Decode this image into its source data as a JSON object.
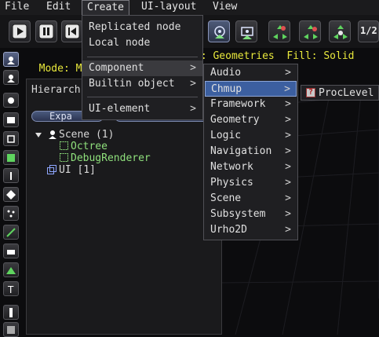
{
  "menubar": {
    "items": [
      {
        "label": "File"
      },
      {
        "label": "Edit"
      },
      {
        "label": "Create",
        "active": true
      },
      {
        "label": "UI-layout"
      },
      {
        "label": "View"
      }
    ]
  },
  "toolbar": {
    "buttons": [
      {
        "icon": "play-icon"
      },
      {
        "icon": "pause-icon"
      },
      {
        "icon": "skip-back-icon"
      },
      {
        "icon": "camera-node-icon",
        "selected": true
      },
      {
        "icon": "camera-local-icon"
      },
      {
        "icon": "move-gizmo-icon"
      },
      {
        "icon": "rotate-gizmo-icon"
      },
      {
        "icon": "scale-gizmo-icon"
      },
      {
        "icon": "half-scale-icon",
        "text": "1/2"
      }
    ]
  },
  "modeline": {
    "left": "Mode: Mov",
    "right": "k: Geometries  Fill: Solid"
  },
  "hierarchy": {
    "title": "Hierarch",
    "expand_label": "Expa",
    "tree": {
      "scene": "Scene (1)",
      "octree": "Octree",
      "debug_renderer": "DebugRenderer",
      "ui": "UI [1]"
    }
  },
  "create_menu": {
    "items": [
      {
        "label": "Replicated node"
      },
      {
        "label": "Local node"
      },
      {
        "label": "Component",
        "submenu": true,
        "highlighted": true
      },
      {
        "label": "Builtin object",
        "submenu": true
      },
      {
        "label": "UI-element",
        "submenu": true
      }
    ],
    "arrow": ">"
  },
  "component_menu": {
    "items": [
      {
        "label": "Audio"
      },
      {
        "label": "Chmup",
        "highlighted": true
      },
      {
        "label": "Framework"
      },
      {
        "label": "Geometry"
      },
      {
        "label": "Logic"
      },
      {
        "label": "Navigation"
      },
      {
        "label": "Network"
      },
      {
        "label": "Physics"
      },
      {
        "label": "Scene"
      },
      {
        "label": "Subsystem"
      },
      {
        "label": "Urho2D"
      }
    ],
    "arrow": ">"
  },
  "chmup_menu": {
    "items": [
      {
        "label": "ProcLevel",
        "icon": "unknown-component-icon",
        "icon_text": "?"
      }
    ]
  },
  "colors": {
    "mode_text": "#e8e83c",
    "tree_component": "#8fe07c",
    "highlight_blue": "#3c5fa0"
  }
}
